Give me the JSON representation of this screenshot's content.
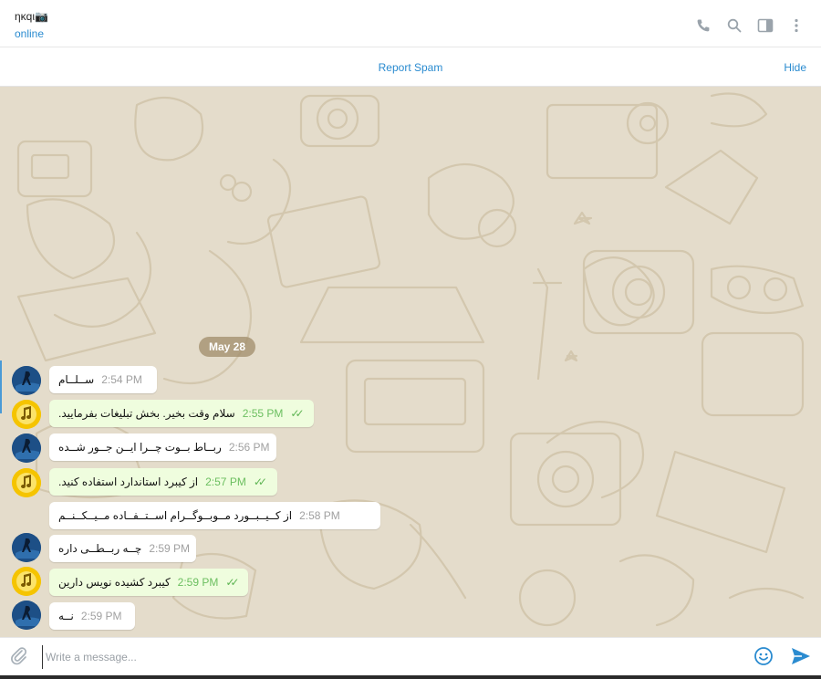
{
  "header": {
    "contact_name": "ηκqι📷",
    "status": "online"
  },
  "spam_bar": {
    "report_label": "Report Spam",
    "hide_label": "Hide"
  },
  "chat": {
    "date_label": "May 28",
    "messages": [
      {
        "text": "ســلــام",
        "time": "2:54 PM",
        "direction": "in"
      },
      {
        "text": "سلام وقت بخیر. بخش تبلیغات بفرمایید.",
        "time": "2:55 PM",
        "direction": "out"
      },
      {
        "text": "ربــاط بــوت چــرا ایــن جــور شــده",
        "time": "2:56 PM",
        "direction": "in"
      },
      {
        "text": "از کیبرد استاندارد استفاده کنید.",
        "time": "2:57 PM",
        "direction": "out"
      },
      {
        "text": "از کــیــبــورد مــوبــوگــرام اســتــفــاده مــیــکــنــم",
        "time": "2:58 PM",
        "direction": "in"
      },
      {
        "text": "چــه ربــطــی داره",
        "time": "2:59 PM",
        "direction": "in"
      },
      {
        "text": "کیبرد کشیده نویس دارین",
        "time": "2:59 PM",
        "direction": "out"
      },
      {
        "text": "نــه",
        "time": "2:59 PM",
        "direction": "in"
      }
    ]
  },
  "composer": {
    "placeholder": "Write a message..."
  },
  "colors": {
    "accent": "#2a8bd0",
    "outgoing_bubble": "#effdde",
    "chat_background": "#e4dccb",
    "read_ticks": "#5fb554"
  },
  "icons": [
    "phone-icon",
    "search-icon",
    "sidebar-toggle-icon",
    "more-icon",
    "attach-icon",
    "emoji-icon",
    "send-icon",
    "read-ticks-icon"
  ]
}
